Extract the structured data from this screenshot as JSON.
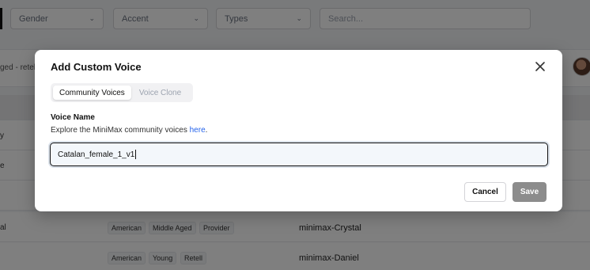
{
  "filters": {
    "gender": {
      "label": "Gender"
    },
    "accent": {
      "label": "Accent"
    },
    "types": {
      "label": "Types"
    },
    "search": {
      "placeholder": "Search..."
    }
  },
  "background": {
    "strip_text": "ged - retell",
    "rows": [
      {
        "stub": "y",
        "tags": [],
        "voice": ""
      },
      {
        "stub": "e",
        "tags": [],
        "voice": ""
      },
      {
        "stub": "",
        "tags": [],
        "voice": ""
      },
      {
        "stub": "al",
        "tags": [
          "American",
          "Middle Aged",
          "Provider"
        ],
        "voice": "minimax-Crystal"
      },
      {
        "stub": "",
        "tags": [
          "American",
          "Young",
          "Retell"
        ],
        "voice": "minimax-Daniel"
      }
    ]
  },
  "modal": {
    "title": "Add Custom Voice",
    "tabs": [
      {
        "label": "Community Voices",
        "active": true
      },
      {
        "label": "Voice Clone",
        "active": false
      }
    ],
    "field_label": "Voice Name",
    "help_text": "Explore the MiniMax community voices",
    "help_link": "here",
    "help_suffix": ".",
    "input_value": "Catalan_female_1_v1",
    "cancel_label": "Cancel",
    "save_label": "Save"
  }
}
